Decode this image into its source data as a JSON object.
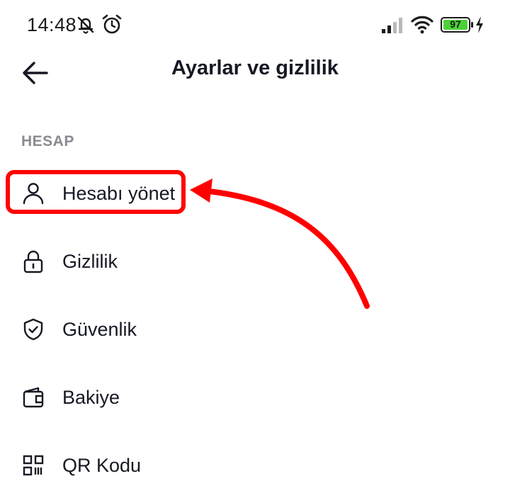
{
  "status_bar": {
    "time": "14:48",
    "battery": "97",
    "icons": [
      "silent-mode-icon",
      "alarm-icon",
      "signal-icon",
      "wifi-icon",
      "battery-icon",
      "charging-icon"
    ]
  },
  "header": {
    "title": "Ayarlar ve gizlilik",
    "back_icon": "arrow-left-icon"
  },
  "section": {
    "label": "HESAP"
  },
  "menu": {
    "items": [
      {
        "label": "Hesabı yönet",
        "icon": "person-icon"
      },
      {
        "label": "Gizlilik",
        "icon": "lock-icon"
      },
      {
        "label": "Güvenlik",
        "icon": "shield-icon"
      },
      {
        "label": "Bakiye",
        "icon": "wallet-icon"
      },
      {
        "label": "QR Kodu",
        "icon": "qr-code-icon"
      }
    ]
  },
  "annotation": {
    "color": "#ff0000",
    "highlighted_item": "Hesabı yönet"
  }
}
